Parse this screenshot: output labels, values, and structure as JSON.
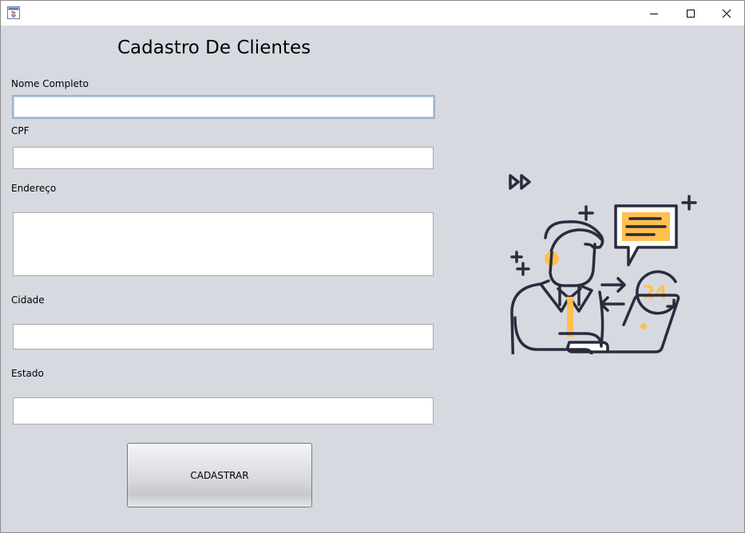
{
  "window": {
    "title": "",
    "controls": {
      "minimize": "minimize",
      "maximize": "maximize",
      "close": "close"
    }
  },
  "form": {
    "title": "Cadastro De Clientes",
    "fields": [
      {
        "label": "Nome Completo",
        "value": "",
        "placeholder": ""
      },
      {
        "label": "CPF",
        "value": "",
        "placeholder": ""
      },
      {
        "label": "Endereço",
        "value": "",
        "placeholder": ""
      },
      {
        "label": "Cidade",
        "value": "",
        "placeholder": ""
      },
      {
        "label": "Estado",
        "value": "",
        "placeholder": ""
      }
    ],
    "submit_label": "CADASTRAR"
  },
  "illustration": {
    "badge_text": "24",
    "icons": [
      "fast-forward-icon",
      "plus-icon",
      "chat-bubble-icon",
      "swap-arrows-icon",
      "24-hour-icon",
      "laptop-icon",
      "headset-icon"
    ]
  },
  "colors": {
    "background": "#d6d9e0",
    "accent": "#ffc04d",
    "outline": "#2a2b3d",
    "focus_border": "#9fb1cd"
  }
}
